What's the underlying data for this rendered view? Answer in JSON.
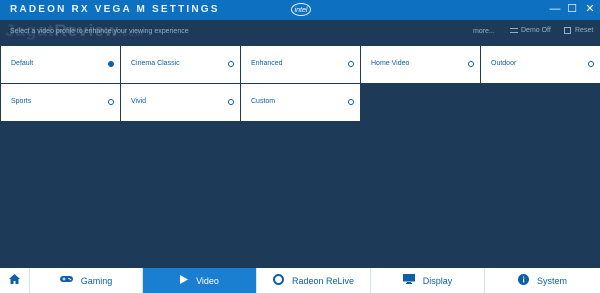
{
  "window": {
    "title": "RADEON RX VEGA M SETTINGS",
    "brand_logo_text": "intel",
    "controls": [
      "minimize",
      "maximize",
      "close"
    ]
  },
  "watermark": {
    "part1": "Jagat",
    "part2": "Review",
    "suffix": ".com"
  },
  "toolbar": {
    "prompt": "Select a video profile to enhance your viewing experience",
    "more_label": "more...",
    "demo_label": "Demo Off",
    "reset_label": "Reset"
  },
  "profiles": [
    {
      "label": "Default",
      "selected": true
    },
    {
      "label": "Cinema Classic",
      "selected": false
    },
    {
      "label": "Enhanced",
      "selected": false
    },
    {
      "label": "Home Video",
      "selected": false
    },
    {
      "label": "Outdoor",
      "selected": false
    },
    {
      "label": "Sports",
      "selected": false
    },
    {
      "label": "Vivid",
      "selected": false
    },
    {
      "label": "Custom",
      "selected": false
    }
  ],
  "nav": {
    "home_icon": "home-icon",
    "items": [
      {
        "label": "Gaming",
        "icon": "gamepad-icon",
        "active": false
      },
      {
        "label": "Video",
        "icon": "play-icon",
        "active": true
      },
      {
        "label": "Radeon ReLive",
        "icon": "relive-icon",
        "active": false
      },
      {
        "label": "Display",
        "icon": "monitor-icon",
        "active": false
      },
      {
        "label": "System",
        "icon": "info-icon",
        "active": false
      }
    ]
  },
  "colors": {
    "accent": "#0d70c0",
    "active_tab": "#1a7fd0",
    "background": "#1d3a58",
    "tile": "#ffffff",
    "text_blue": "#0d5fa8"
  }
}
